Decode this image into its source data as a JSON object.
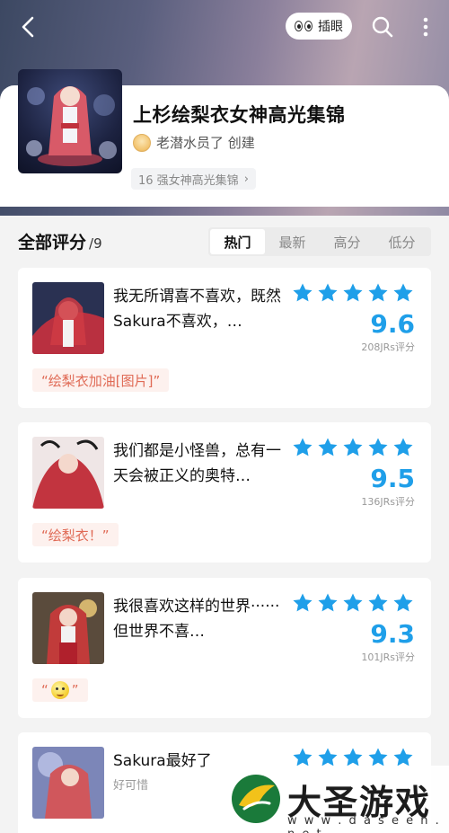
{
  "header": {
    "peek_label": "插眼"
  },
  "collection": {
    "title": "上杉绘梨衣女神高光集锦",
    "creator": "老潜水员了 创建",
    "tag": "16 强女神高光集锦",
    "tag_chevron": "›"
  },
  "ratings": {
    "title": "全部评分",
    "count": "/9",
    "sort_tabs": [
      "热门",
      "最新",
      "高分",
      "低分"
    ],
    "active_tab": "热门"
  },
  "reviews": [
    {
      "text": "我无所谓喜不喜欢，既然Sakura不喜欢，…",
      "stars": 5,
      "score": "9.6",
      "jrs": "208JRs评分",
      "quote": "“绘梨衣加油[图片]”"
    },
    {
      "text": "我们都是小怪兽，总有一天会被正义的奥特…",
      "stars": 5,
      "score": "9.5",
      "jrs": "136JRs评分",
      "quote": "“绘梨衣！”"
    },
    {
      "text": "我很喜欢这样的世界······但世界不喜…",
      "stars": 5,
      "score": "9.3",
      "jrs": "101JRs评分",
      "quote_open": "“",
      "quote_close": "”"
    },
    {
      "text": "Sakura最好了",
      "sub": "好可惜",
      "stars": 5
    }
  ],
  "watermark": {
    "title": "大圣游戏网",
    "url": "w w w . d a s e e n . n e t"
  },
  "colors": {
    "accent": "#1f9fe9",
    "quote": "#e06a55"
  }
}
